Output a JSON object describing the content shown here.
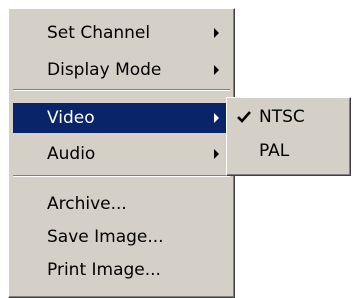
{
  "context_menu": {
    "items": [
      {
        "label": "Set Channel",
        "has_submenu": true
      },
      {
        "label": "Display Mode",
        "has_submenu": true
      },
      {
        "label": "Video",
        "has_submenu": true,
        "highlighted": true
      },
      {
        "label": "Audio",
        "has_submenu": true
      },
      {
        "label": "Archive..."
      },
      {
        "label": "Save Image..."
      },
      {
        "label": "Print Image..."
      }
    ]
  },
  "video_submenu": {
    "items": [
      {
        "label": "NTSC",
        "checked": true,
        "icon": "checkmark-icon"
      },
      {
        "label": "PAL",
        "checked": false
      }
    ]
  },
  "colors": {
    "menu_background": "#d4d0c8",
    "highlight_background": "#0a246a",
    "highlight_text": "#ffffff",
    "separator_shadow": "#808080"
  }
}
